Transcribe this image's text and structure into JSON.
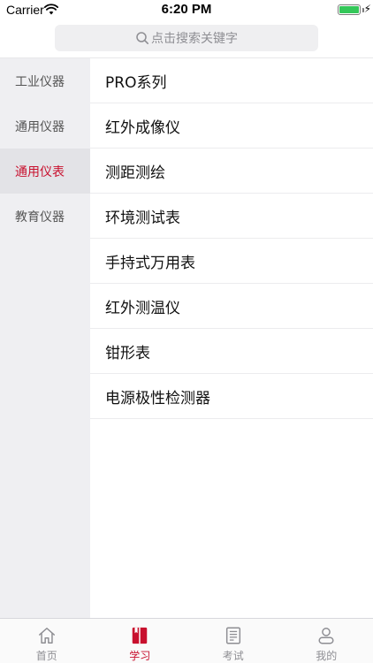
{
  "status_bar": {
    "carrier": "Carrier",
    "time": "6:20 PM",
    "battery_level": 1.0
  },
  "search": {
    "placeholder": "点击搜索关键字"
  },
  "categories": [
    {
      "label": "工业仪器",
      "active": false
    },
    {
      "label": "通用仪器",
      "active": false
    },
    {
      "label": "通用仪表",
      "active": true
    },
    {
      "label": "教育仪器",
      "active": false
    }
  ],
  "items": [
    {
      "label": "PRO系列"
    },
    {
      "label": "红外成像仪"
    },
    {
      "label": "测距测绘"
    },
    {
      "label": "环境测试表"
    },
    {
      "label": "手持式万用表"
    },
    {
      "label": "红外测温仪"
    },
    {
      "label": "钳形表"
    },
    {
      "label": "电源极性检测器"
    }
  ],
  "tabs": [
    {
      "label": "首页",
      "icon": "home-icon",
      "active": false
    },
    {
      "label": "学习",
      "icon": "book-icon",
      "active": true
    },
    {
      "label": "考试",
      "icon": "exam-icon",
      "active": false
    },
    {
      "label": "我的",
      "icon": "profile-icon",
      "active": false
    }
  ],
  "colors": {
    "accent": "#c8102e",
    "inactive": "#8e8e93",
    "sidebar_bg": "#efeff2",
    "sidebar_active_bg": "#e3e3e7",
    "battery": "#34c759"
  }
}
